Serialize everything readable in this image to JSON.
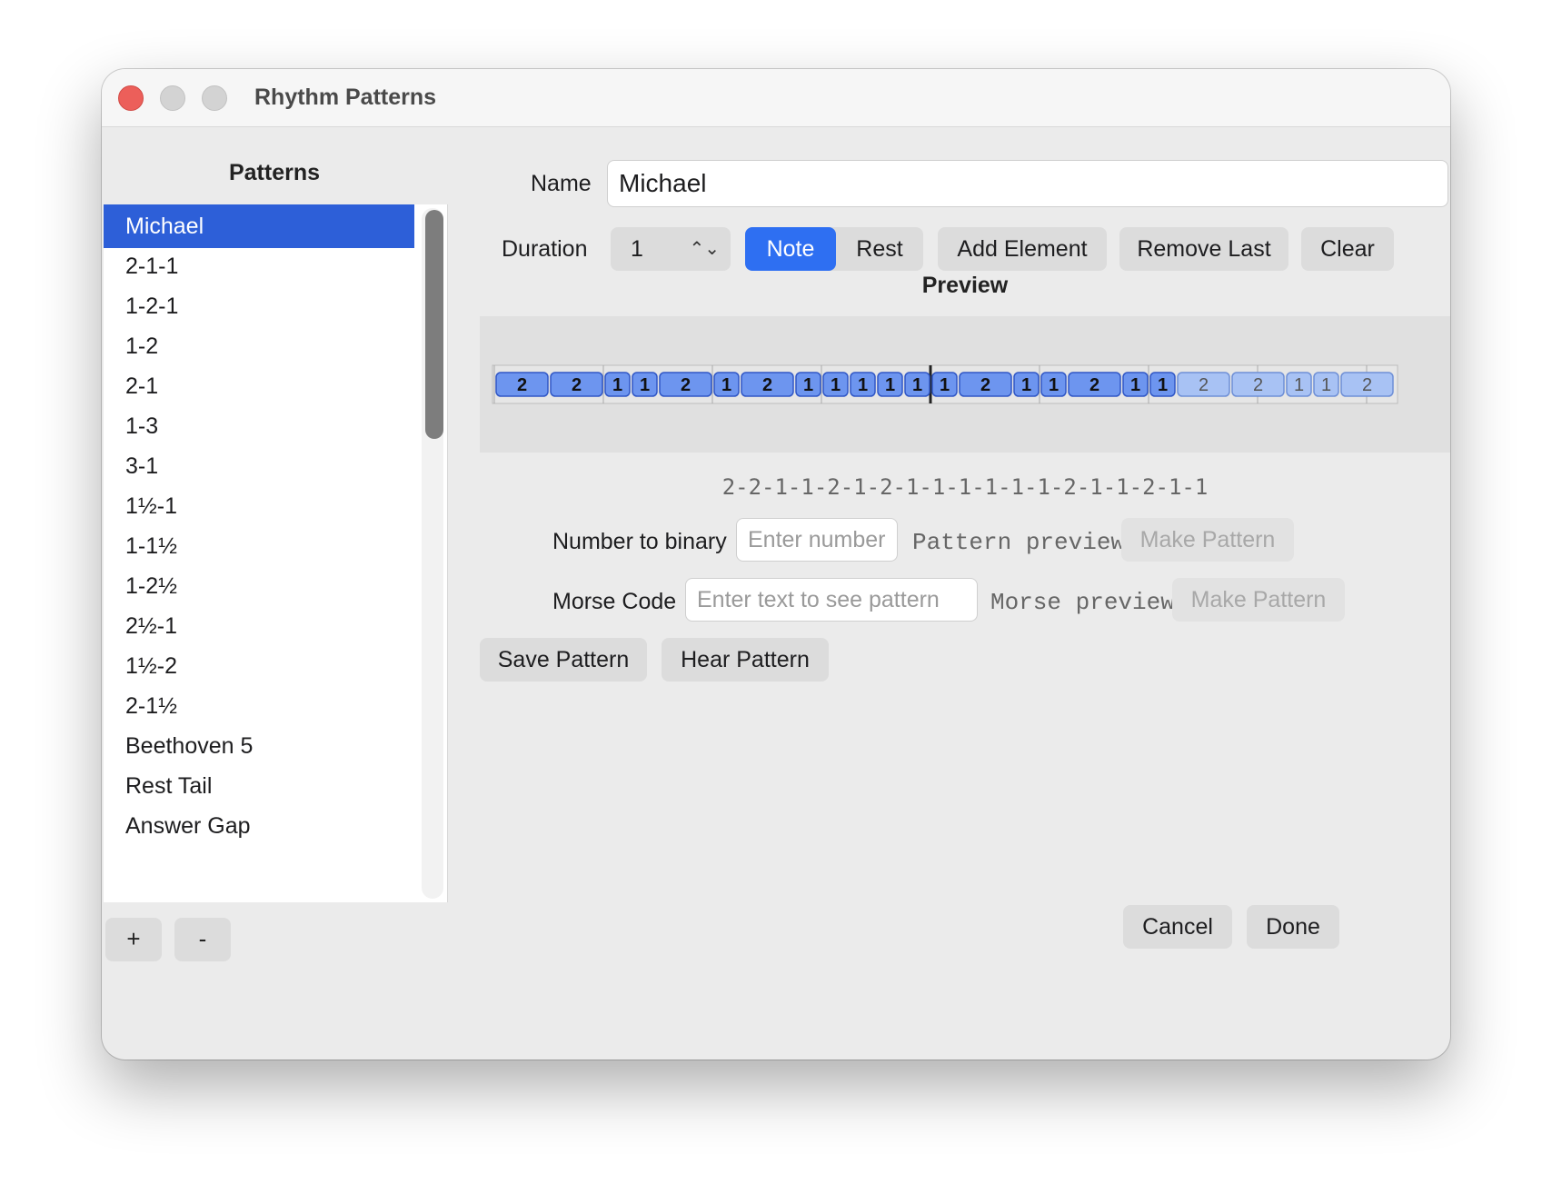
{
  "window": {
    "title": "Rhythm Patterns"
  },
  "sidebar": {
    "header": "Patterns",
    "items": [
      {
        "label": "Michael",
        "selected": true
      },
      {
        "label": "2-1-1"
      },
      {
        "label": "1-2-1"
      },
      {
        "label": "1-2"
      },
      {
        "label": "2-1"
      },
      {
        "label": "1-3"
      },
      {
        "label": "3-1"
      },
      {
        "label": "1½-1"
      },
      {
        "label": "1-1½"
      },
      {
        "label": "1-2½"
      },
      {
        "label": "2½-1"
      },
      {
        "label": "1½-2"
      },
      {
        "label": "2-1½"
      },
      {
        "label": "Beethoven 5"
      },
      {
        "label": "Rest Tail"
      },
      {
        "label": "Answer Gap"
      }
    ],
    "add_label": "+",
    "remove_label": "-"
  },
  "editor": {
    "name_label": "Name",
    "name_value": "Michael",
    "duration_label": "Duration",
    "duration_value": "1",
    "note_label": "Note",
    "rest_label": "Rest",
    "selected_type": "Note",
    "add_element_label": "Add Element",
    "remove_last_label": "Remove Last",
    "clear_label": "Clear",
    "preview_title": "Preview",
    "pattern_string": "2-2-1-1-2-1-2-1-1-1-1-1-1-2-1-1-2-1-1",
    "number_to_binary_label": "Number to binary",
    "number_placeholder": "Enter number",
    "pattern_preview": "Pattern preview",
    "make_pattern_label": "Make Pattern",
    "morse_label": "Morse Code",
    "morse_placeholder": "Enter text to see pattern",
    "morse_preview": "Morse preview",
    "make_pattern_morse_label": "Make Pattern",
    "save_label": "Save Pattern",
    "hear_label": "Hear Pattern"
  },
  "preview_blocks": {
    "primary": [
      "2",
      "2",
      "1",
      "1",
      "2",
      "1",
      "2",
      "1",
      "1",
      "1",
      "1",
      "1",
      "1",
      "2",
      "1",
      "1",
      "2",
      "1",
      "1"
    ],
    "faded": [
      "2",
      "2",
      "1",
      "1",
      "2"
    ]
  },
  "footer": {
    "cancel_label": "Cancel",
    "done_label": "Done"
  },
  "colors": {
    "accent": "#2e6ff2",
    "selection": "#2d5fd8",
    "block_fill": "#6d95ef",
    "block_faded": "#a8c2f4"
  }
}
